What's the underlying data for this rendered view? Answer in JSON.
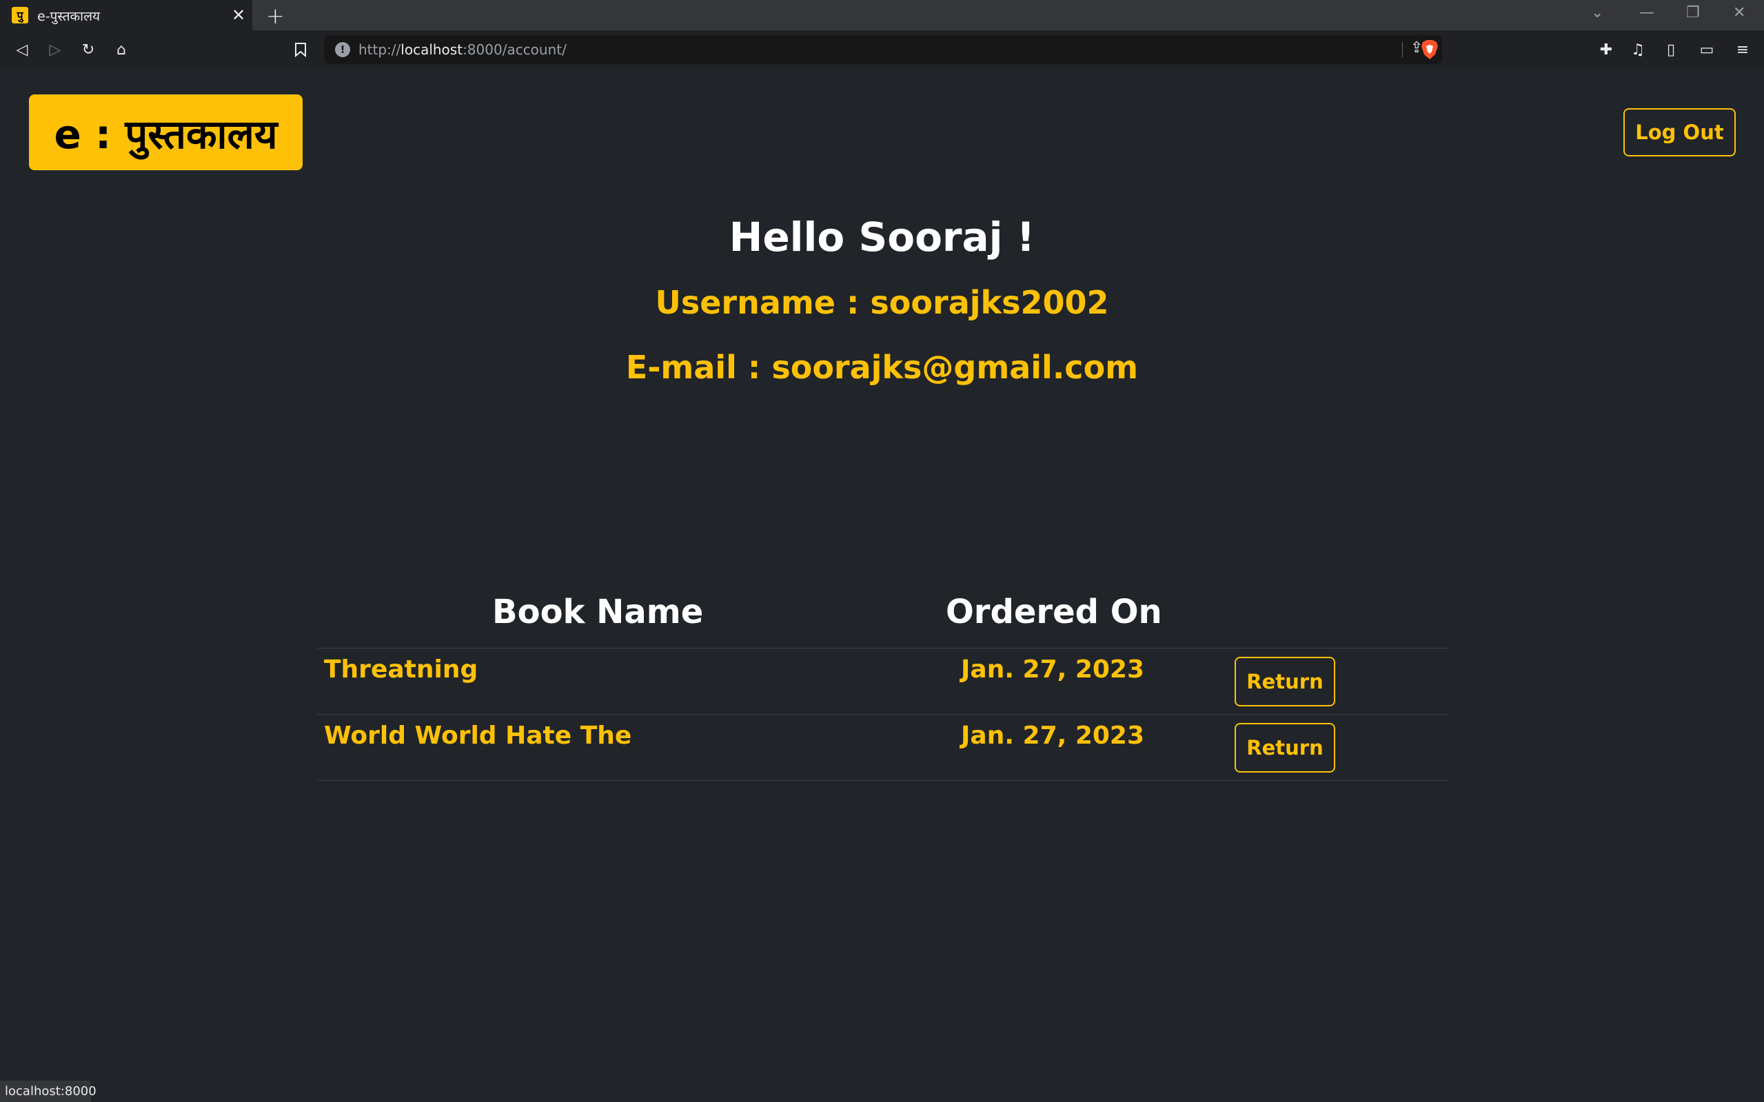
{
  "browser": {
    "tab_title": "e-पुस्तकालय",
    "tab_favicon_glyph": "पु",
    "url_scheme": "http://",
    "url_host": "localhost",
    "url_rest": ":8000/account/",
    "status_text": "localhost:8000"
  },
  "header": {
    "brand": "e : पुस्तकालय",
    "logout_label": "Log Out"
  },
  "profile": {
    "greeting": "Hello Sooraj !",
    "username_line": "Username : soorajks2002",
    "email_line": "E-mail : soorajks@gmail.com"
  },
  "orders": {
    "columns": [
      "Book Name",
      "Ordered On"
    ],
    "rows": [
      {
        "book": "Threatning",
        "date": "Jan. 27, 2023",
        "action": "Return"
      },
      {
        "book": "World World Hate The",
        "date": "Jan. 27, 2023",
        "action": "Return"
      }
    ]
  },
  "colors": {
    "accent": "#ffc107",
    "page_bg": "#212529",
    "text": "#ffffff"
  }
}
